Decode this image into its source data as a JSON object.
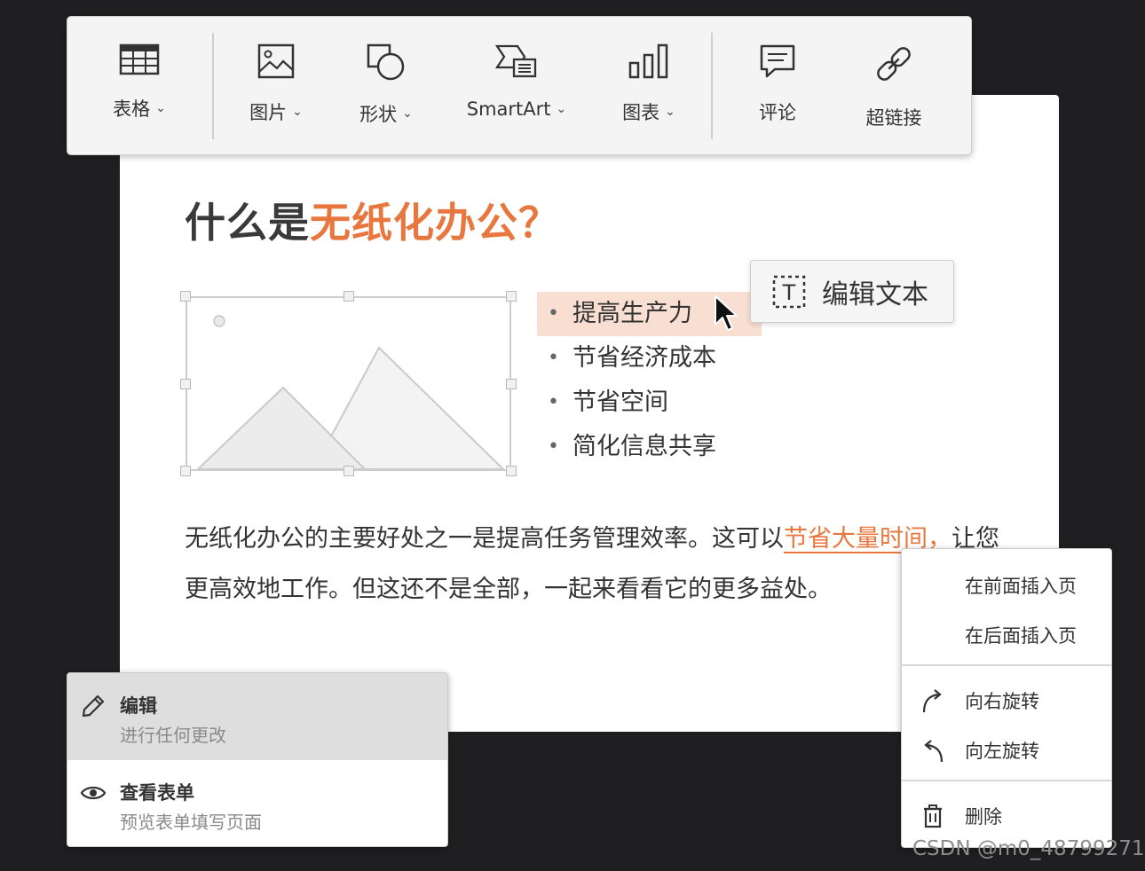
{
  "toolbar": {
    "items": [
      {
        "label": "表格",
        "icon": "table-icon",
        "dropdown": true
      },
      {
        "label": "图片",
        "icon": "image-icon",
        "dropdown": true
      },
      {
        "label": "形状",
        "icon": "shapes-icon",
        "dropdown": true
      },
      {
        "label": "SmartArt",
        "icon": "smartart-icon",
        "dropdown": true
      },
      {
        "label": "图表",
        "icon": "chart-icon",
        "dropdown": true
      },
      {
        "label": "评论",
        "icon": "comment-icon",
        "dropdown": false
      },
      {
        "label": "超链接",
        "icon": "link-icon",
        "dropdown": false
      }
    ],
    "chevron": "⌄"
  },
  "slide": {
    "title_prefix": "什么是",
    "title_accent": "无纸化办公？",
    "bullets": [
      "提高生产力",
      "节省经济成本",
      "节省空间",
      "简化信息共享"
    ],
    "paragraph": {
      "before_link": "无纸化办公的主要好处之一是提高任务管理效率。这可以",
      "link": "节省大量时间，",
      "after_link": "让您更高效地工作。但这还不是全部，一起来看看它的更多益处。"
    }
  },
  "edit_text": {
    "label": "编辑文本",
    "icon": "text-box-icon"
  },
  "left_menu": {
    "items": [
      {
        "title": "编辑",
        "subtitle": "进行任何更改",
        "icon": "pencil-icon",
        "active": true
      },
      {
        "title": "查看表单",
        "subtitle": "预览表单填写页面",
        "icon": "eye-icon",
        "active": false
      }
    ]
  },
  "context_menu": {
    "items": [
      {
        "label": "在前面插入页"
      },
      {
        "label": "在后面插入页"
      },
      {
        "label": "向右旋转",
        "icon": "rotate-right-icon"
      },
      {
        "label": "向左旋转",
        "icon": "rotate-left-icon"
      },
      {
        "label": "删除",
        "icon": "trash-icon"
      }
    ]
  },
  "colors": {
    "accent": "#e8773f",
    "highlight": "#f8dfd2",
    "background": "#1f1f21"
  },
  "watermark": "CSDN @m0_48799271"
}
